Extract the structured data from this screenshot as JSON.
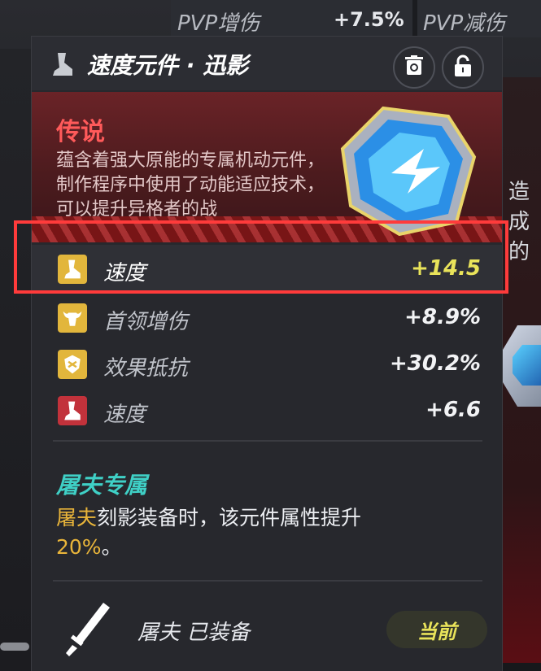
{
  "background": {
    "top_bar": {
      "left_label": "PVP增伤",
      "value": "+7.5%",
      "right_label": "PVP减伤"
    },
    "right_text": "造成的"
  },
  "card": {
    "title": "速度元件 · 迅影",
    "icons": {
      "title_icon": "boot-icon",
      "recycle_icon": "recycle-icon",
      "lock_icon": "lock-icon"
    },
    "rarity": {
      "label": "传说",
      "description": "蕴含着强大原能的专属机动元件，制作程序中使用了动能适应技术，可以提升异格者的战"
    },
    "main_stat": {
      "name": "速度",
      "value": "+14.5",
      "icon": "boot-icon"
    },
    "sub_stats": [
      {
        "name": "首领增伤",
        "value": "+8.9%",
        "icon": "bull-head-icon"
      },
      {
        "name": "效果抵抗",
        "value": "+30.2%",
        "icon": "shield-break-icon"
      },
      {
        "name": "速度",
        "value": "+6.6",
        "icon": "boot-icon"
      }
    ],
    "exclusive": {
      "title": "屠夫专属",
      "desc_highlight_name": "屠夫",
      "desc_mid": "刻影装备时，该元件属性提升",
      "desc_highlight_pct": "20%",
      "desc_end": "。"
    },
    "equip": {
      "icon": "sword-icon",
      "text": "屠夫 已装备",
      "current_label": "当前"
    }
  },
  "colors": {
    "legendary": "#ff5a5a",
    "main_stat_value": "#e9e35a",
    "exclusive_title": "#3fd0c6",
    "highlight": "#e9b53a",
    "annotation_box": "#ff3b3b"
  }
}
